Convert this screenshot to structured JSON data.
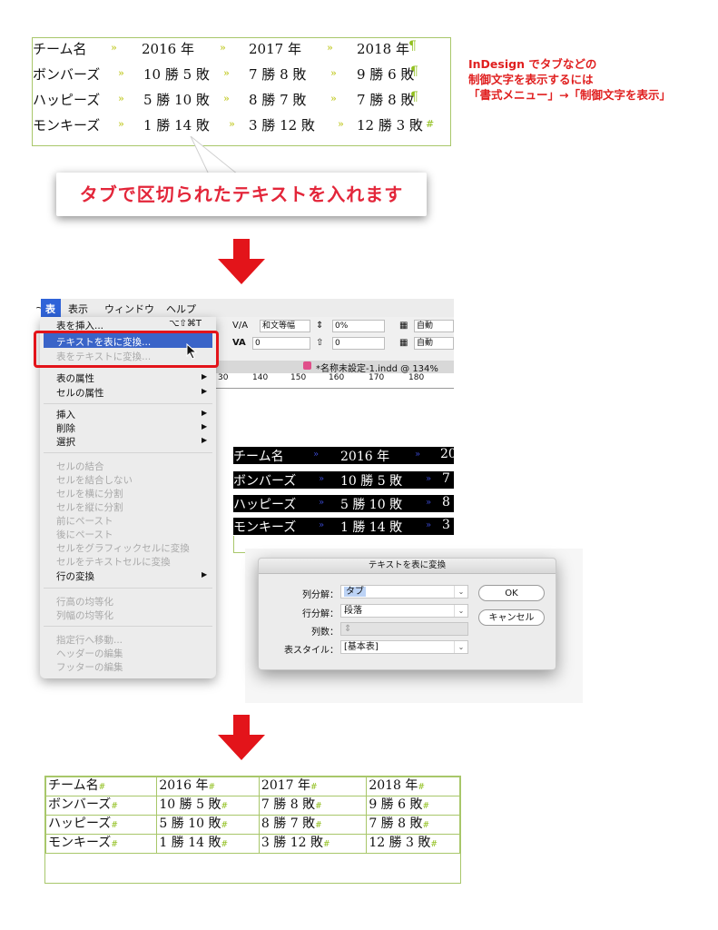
{
  "top_table": {
    "rows": [
      [
        "チーム名",
        "2016 年",
        "2017 年",
        "2018 年"
      ],
      [
        "ボンバーズ",
        "10 勝 5 敗",
        "7 勝 8 敗",
        "9 勝 6 敗"
      ],
      [
        "ハッピーズ",
        "5 勝 10 敗",
        "8 勝 7 敗",
        "7 勝 8 敗"
      ],
      [
        "モンキーズ",
        "1 勝 14 敗",
        "3 勝 12 敗",
        "12 勝 3 敗"
      ]
    ],
    "tab_mark": "»",
    "para_mark": "¶",
    "end_mark": "#"
  },
  "note": {
    "line1": "InDesign でタブなどの",
    "line2": "制御文字を表示するには",
    "line3": "「書式メニュー」→「制御文字を表示」"
  },
  "callout": {
    "text": "タブで区切られたテキストを入れます"
  },
  "colors": {
    "accent_red": "#e3141a",
    "frame_green": "#a8c76a",
    "menu_highlight": "#3a64c8"
  },
  "menubar": {
    "items": [
      "表",
      "表示",
      "ウィンドウ",
      "ヘルプ"
    ],
    "left_fragment": "~"
  },
  "toolbar": {
    "kerning_value": "和文等幅",
    "tracking_value": "0%",
    "field_zero_1": "0",
    "field_zero_2": "0",
    "auto_1": "自動",
    "auto_2": "自動"
  },
  "document_tab": {
    "title": "*名称未設定-1.indd @ 134%"
  },
  "ruler": {
    "ticks": [
      "30",
      "140",
      "150",
      "160",
      "170",
      "180"
    ]
  },
  "table_menu": {
    "insert_table": "表を挿入...",
    "insert_table_shortcut": "⌥⇧⌘T",
    "convert_text_to_table": "テキストを表に変換...",
    "convert_table_to_text": "表をテキストに変換...",
    "table_options": "表の属性",
    "cell_options": "セルの属性",
    "insert": "挿入",
    "delete": "削除",
    "select": "選択",
    "merge_cells": "セルの結合",
    "unmerge_cells": "セルを結合しない",
    "split_horizontal": "セルを横に分割",
    "split_vertical": "セルを縦に分割",
    "paste_before": "前にペースト",
    "paste_after": "後にペースト",
    "to_graphic_cell": "セルをグラフィックセルに変換",
    "to_text_cell": "セルをテキストセルに変換",
    "convert_rows": "行の変換",
    "distribute_rows": "行高の均等化",
    "distribute_columns": "列幅の均等化",
    "go_to_row": "指定行へ移動...",
    "edit_header": "ヘッダーの編集",
    "edit_footer": "フッターの編集"
  },
  "selected_text": {
    "rows": [
      [
        "チーム名",
        "2016 年",
        "20"
      ],
      [
        "ボンバーズ",
        "10 勝 5 敗",
        "7"
      ],
      [
        "ハッピーズ",
        "5 勝 10 敗",
        "8"
      ],
      [
        "モンキーズ",
        "1 勝 14 敗",
        "3"
      ]
    ]
  },
  "dialog": {
    "title": "テキストを表に変換",
    "column_separator_label": "列分解：",
    "column_separator_value": "タブ",
    "row_separator_label": "行分解：",
    "row_separator_value": "段落",
    "column_count_label": "列数：",
    "table_style_label": "表スタイル：",
    "table_style_value": "[基本表]",
    "ok": "OK",
    "cancel": "キャンセル"
  },
  "bottom_table": {
    "rows": [
      [
        "チーム名",
        "2016 年",
        "2017 年",
        "2018 年"
      ],
      [
        "ボンバーズ",
        "10 勝 5 敗",
        "7 勝 8 敗",
        "9 勝 6 敗"
      ],
      [
        "ハッピーズ",
        "5 勝 10 敗",
        "8 勝 7 敗",
        "7 勝 8 敗"
      ],
      [
        "モンキーズ",
        "1 勝 14 敗",
        "3 勝 12 敗",
        "12 勝 3 敗"
      ]
    ],
    "cell_mark": "#"
  }
}
